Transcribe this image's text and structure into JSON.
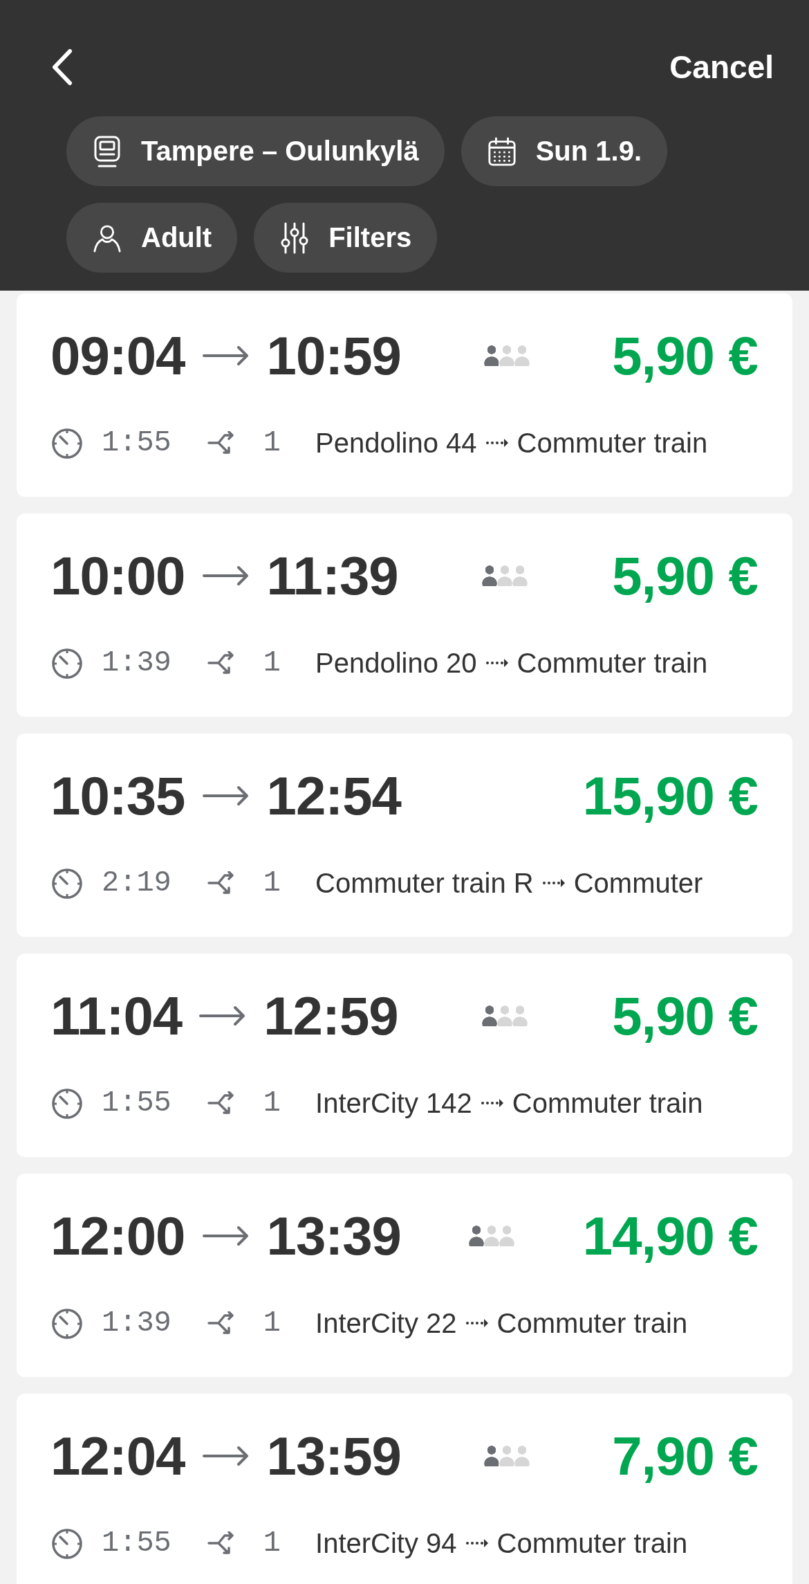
{
  "header": {
    "cancel": "Cancel"
  },
  "chips": [
    {
      "kind": "route",
      "label": "Tampere – Oulunkylä"
    },
    {
      "kind": "date",
      "label": "Sun 1.9."
    },
    {
      "kind": "passengers",
      "label": "Adult"
    },
    {
      "kind": "filters",
      "label": "Filters"
    }
  ],
  "trips": [
    {
      "departure": "09:04",
      "arrival": "10:59",
      "occupancy": {
        "level": 0.33
      },
      "price": "5,90 €",
      "duration": "1:55",
      "transfers": "1",
      "legs": [
        "Pendolino 44",
        "Commuter train"
      ]
    },
    {
      "departure": "10:00",
      "arrival": "11:39",
      "occupancy": {
        "level": 0.33
      },
      "price": "5,90 €",
      "duration": "1:39",
      "transfers": "1",
      "legs": [
        "Pendolino 20",
        "Commuter train"
      ]
    },
    {
      "departure": "10:35",
      "arrival": "12:54",
      "price": "15,90 €",
      "duration": "2:19",
      "transfers": "1",
      "legs": [
        "Commuter train R",
        "Commuter"
      ]
    },
    {
      "departure": "11:04",
      "arrival": "12:59",
      "occupancy": {
        "level": 0.33
      },
      "price": "5,90 €",
      "duration": "1:55",
      "transfers": "1",
      "legs": [
        "InterCity 142",
        "Commuter train"
      ]
    },
    {
      "departure": "12:00",
      "arrival": "13:39",
      "occupancy": {
        "level": 0.33
      },
      "price": "14,90 €",
      "duration": "1:39",
      "transfers": "1",
      "legs": [
        "InterCity 22",
        "Commuter train"
      ]
    },
    {
      "departure": "12:04",
      "arrival": "13:59",
      "occupancy": {
        "level": 0.33
      },
      "price": "7,90 €",
      "duration": "1:55",
      "transfers": "1",
      "legs": [
        "InterCity 94",
        "Commuter train"
      ]
    }
  ]
}
